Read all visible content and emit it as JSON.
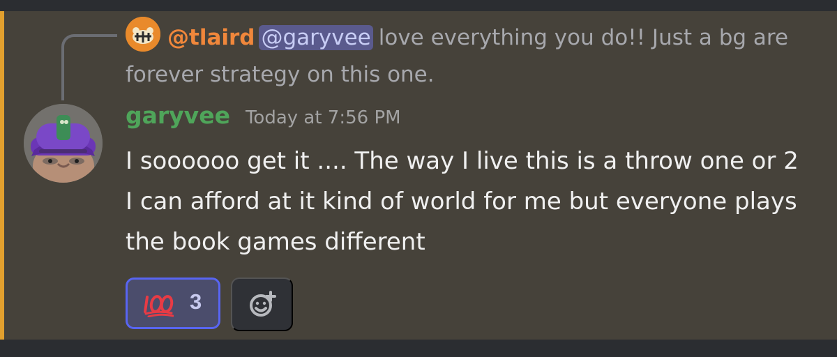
{
  "colors": {
    "app_background": "#2b2d31",
    "highlighted_message_background": "#46423a",
    "mention_bar": "#e2a02e",
    "reply_author": "#f0873b",
    "mention_chip_background": "#5a5a8d",
    "author": "#4fa55a",
    "reaction_border": "#5865f2"
  },
  "reply": {
    "avatar_icon": "tiger-avatar-icon",
    "author": "@tlaird",
    "mention": "@garyvee",
    "text": "love everything you do!!  Just a bg are forever strategy on this one."
  },
  "message": {
    "avatar_icon": "garyvee-avatar-icon",
    "author": "garyvee",
    "timestamp": "Today at 7:56 PM",
    "content": "I soooooo get it .... The way I live this is a throw one or 2 I can afford at it kind of world for me but everyone plays the book games different"
  },
  "reactions": [
    {
      "emoji": "hundred-points-icon",
      "emoji_text": "💯",
      "count": "3",
      "selected": true
    }
  ],
  "add_reaction": {
    "icon": "add-reaction-icon"
  }
}
